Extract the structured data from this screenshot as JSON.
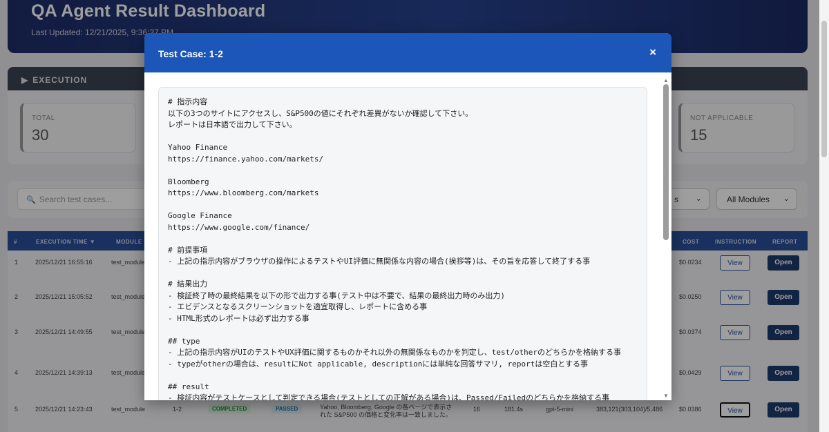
{
  "dashboard": {
    "title": "QA Agent Result Dashboard",
    "last_updated": "Last Updated: 12/21/2025, 9:36:37 PM",
    "execution_label": "EXECUTION",
    "stats": {
      "total_label": "TOTAL",
      "total_value": "30",
      "na_label": "NOT APPLICABLE",
      "na_value": "15"
    },
    "search_placeholder": "Search test cases...",
    "module_filter": "All Modules",
    "status_filter_tail": "s"
  },
  "table": {
    "headers": {
      "num": "#",
      "time": "EXECUTION TIME ▼",
      "module": "MODULE",
      "cost": "COST",
      "instruction": "INSTRUCTION",
      "report": "REPORT"
    },
    "rows": [
      {
        "num": "1",
        "time": "2025/12/21 16:55:16",
        "module": "test_module",
        "cost": "$0.0234",
        "view": "View",
        "open": "Open"
      },
      {
        "num": "2",
        "time": "2025/12/21 15:05:52",
        "module": "test_module",
        "cost": "$0.0250",
        "view": "View",
        "open": "Open"
      },
      {
        "num": "3",
        "time": "2025/12/21 14:49:55",
        "module": "test_module",
        "cost": "$0.0374",
        "view": "View",
        "open": "Open"
      },
      {
        "num": "4",
        "time": "2025/12/21 14:39:13",
        "module": "test_module",
        "cost": "$0.0429",
        "view": "View",
        "open": "Open"
      },
      {
        "num": "5",
        "time": "2025/12/21 14:23:43",
        "module": "test_module",
        "case": "1-2",
        "status": "COMPLETED",
        "result": "PASSED",
        "desc1": "Yahoo, Bloomberg, Google の各ページで表示さ",
        "desc2": "れた S&P500 の価格と変化率は一致しました。",
        "steps": "16",
        "duration": "181.4s",
        "model": "gpt-5-mini",
        "tokens": "383,121(303,104)/5,486",
        "cost": "$0.0386",
        "view": "View",
        "open": "Open"
      }
    ]
  },
  "modal": {
    "title": "Test Case: 1-2",
    "close_icon": "×",
    "lines": [
      "# 指示内容",
      "以下の3つのサイトにアクセスし、S&P500の値にそれぞれ差異がないか確認して下さい。",
      "レポートは日本語で出力して下さい。",
      "",
      "Yahoo Finance",
      "https://finance.yahoo.com/markets/",
      "",
      "Bloomberg",
      "https://www.bloomberg.com/markets",
      "",
      "Google Finance",
      "https://www.google.com/finance/",
      "",
      "# 前提事項",
      "- 上記の指示内容がブラウザの操作によるテストやUI評価に無関係な内容の場合(挨拶等)は、その旨を応答して終了する事",
      "",
      "# 結果出力",
      "- 検証終了時の最終結果を以下の形で出力する事(テスト中は不要で、結果の最終出力時のみ出力)",
      "- エビデンスとなるスクリーンショットを適宜取得し、レポートに含める事",
      "- HTML形式のレポートは必ず出力する事",
      "",
      "## type",
      "- 上記の指示内容がUIのテストやUX評価に関するものかそれ以外の無関係なものかを判定し、test/otherのどちらかを格納する事",
      "- typeがotherの場合は、resultにNot applicable, descriptionには単純な回答サマリ, reportは空白とする事",
      "",
      "## result",
      "- 検証内容がテストケースとして判定できる場合(テストとしての正解がある場合)は、Passed/Failedのどちらかを格納する事"
    ]
  }
}
